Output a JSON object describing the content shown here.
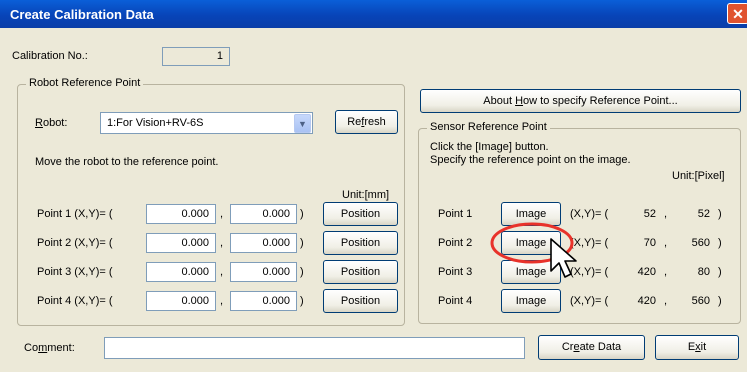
{
  "window": {
    "title": "Create Calibration Data",
    "close_glyph": "✕"
  },
  "calibration": {
    "label": "Calibration No.:",
    "value": "1"
  },
  "robot_group": {
    "title": "Robot Reference Point",
    "robot_label_pre": "",
    "robot_label_ul": "R",
    "robot_label_post": "obot:",
    "robot_value": "1:For Vision+RV-6S",
    "refresh_pre": "Re",
    "refresh_ul": "f",
    "refresh_post": "resh",
    "instruction": "Move the robot to the reference point.",
    "unit": "Unit:[mm]",
    "position_label": "Position",
    "rows": [
      {
        "label": "Point 1 (X,Y)= (",
        "x": "0.000",
        "sep": ",",
        "y": "0.000",
        "close": ")"
      },
      {
        "label": "Point 2 (X,Y)= (",
        "x": "0.000",
        "sep": ",",
        "y": "0.000",
        "close": ")"
      },
      {
        "label": "Point 3 (X,Y)= (",
        "x": "0.000",
        "sep": ",",
        "y": "0.000",
        "close": ")"
      },
      {
        "label": "Point 4 (X,Y)= (",
        "x": "0.000",
        "sep": ",",
        "y": "0.000",
        "close": ")"
      }
    ]
  },
  "about_button": {
    "pre": "About ",
    "ul": "H",
    "post": "ow to specify Reference Point..."
  },
  "sensor_group": {
    "title": "Sensor Reference Point",
    "line1": "Click the [Image] button.",
    "line2": "Specify the reference point on the image.",
    "unit": "Unit:[Pixel]",
    "image_label": "Image",
    "rows": [
      {
        "label": "Point 1",
        "coord": "(X,Y)= (",
        "x": "52",
        "sep": ",",
        "y": "52",
        "close": ")"
      },
      {
        "label": "Point 2",
        "coord": "(X,Y)= (",
        "x": "70",
        "sep": ",",
        "y": "560",
        "close": ")"
      },
      {
        "label": "Point 3",
        "coord": "(X,Y)= (",
        "x": "420",
        "sep": ",",
        "y": "80",
        "close": ")"
      },
      {
        "label": "Point 4",
        "coord": "(X,Y)= (",
        "x": "420",
        "sep": ",",
        "y": "560",
        "close": ")"
      }
    ]
  },
  "comment": {
    "pre": "Co",
    "ul": "m",
    "post": "ment:",
    "value": ""
  },
  "create_button": {
    "pre": "Cr",
    "ul": "e",
    "post": "ate Data"
  },
  "exit_button": {
    "pre": "E",
    "ul": "x",
    "post": "it"
  },
  "highlight_color": "#e8322a"
}
